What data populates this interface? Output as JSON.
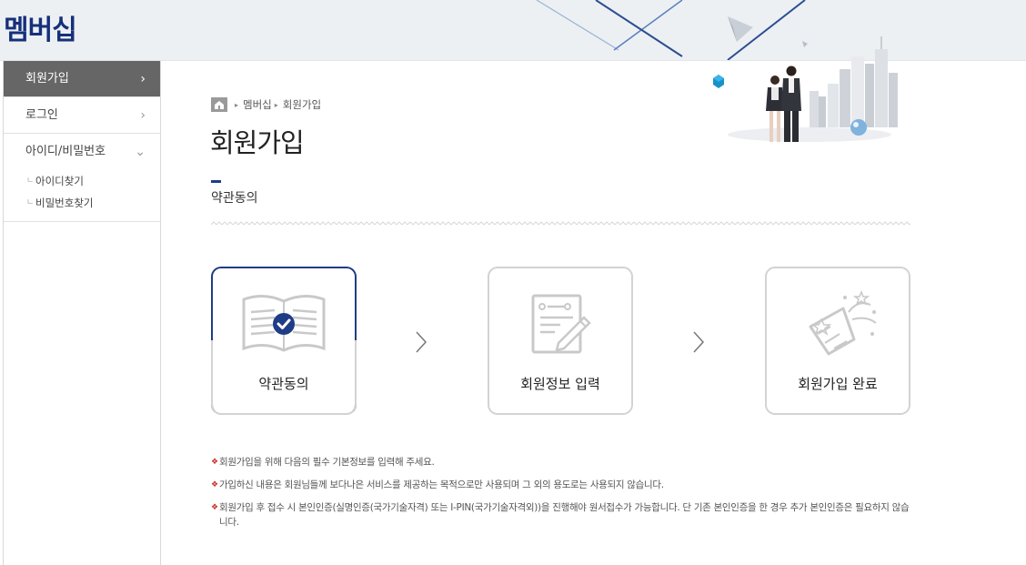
{
  "header": {
    "site_title": "멤버십"
  },
  "sidebar": {
    "items": [
      {
        "label": "회원가입",
        "arrow": "›",
        "active": true
      },
      {
        "label": "로그인",
        "arrow": "›"
      },
      {
        "label": "아이디/비밀번호",
        "arrow": "⌄"
      }
    ],
    "sub_items": [
      {
        "label": "아이디찾기",
        "dot": "ㄴ"
      },
      {
        "label": "비밀번호찾기",
        "dot": "ㄴ"
      }
    ]
  },
  "breadcrumb": {
    "items": [
      "멤버십",
      "회원가입"
    ],
    "separator": "▸"
  },
  "page": {
    "title": "회원가입",
    "subtitle": "약관동의"
  },
  "steps": [
    {
      "label": "약관동의",
      "icon": "book-check-icon",
      "active": true
    },
    {
      "label": "회원정보 입력",
      "icon": "document-pen-icon"
    },
    {
      "label": "회원가입 완료",
      "icon": "party-popper-icon"
    }
  ],
  "notes": {
    "bullet": "❖",
    "items": [
      "회원가입을 위해 다음의 필수 기본정보를 입력해 주세요.",
      "가입하신 내용은 회원님들께 보다나은 서비스를 제공하는 목적으로만 사용되며 그 외의 용도로는 사용되지 않습니다.",
      "회원가입 후 접수 시 본인인증(실명인증(국가기술자격) 또는 I-PIN(국가기술자격외))을 진행해야 원서접수가 가능합니다. 단 기존 본인인증을 한 경우 추가 본인인증은 필요하지 않습니다."
    ]
  },
  "colors": {
    "brand": "#16307a",
    "accent": "#1f3c86",
    "bullet": "#c9302c",
    "sidebar_active": "#666666"
  }
}
